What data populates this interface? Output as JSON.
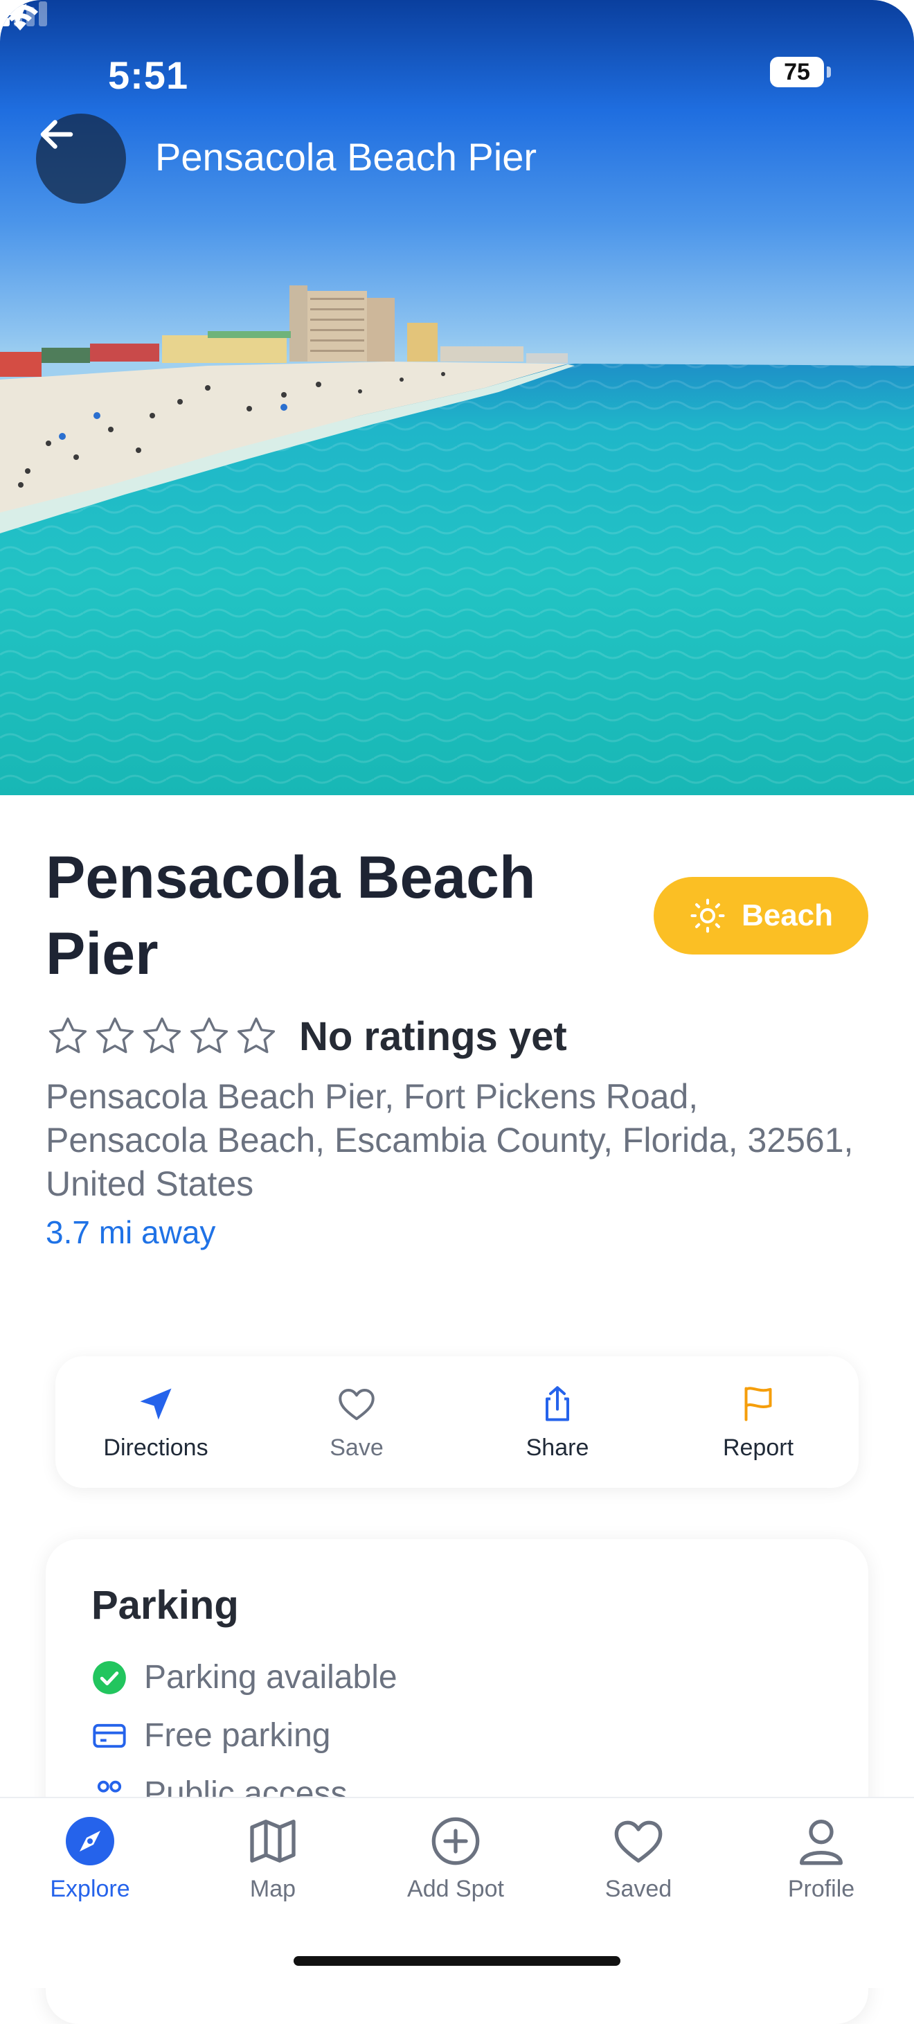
{
  "status_bar": {
    "time": "5:51",
    "battery": "75"
  },
  "header": {
    "title": "Pensacola Beach Pier",
    "back_icon": "arrow-left-icon"
  },
  "place": {
    "name": "Pensacola Beach Pier",
    "category": "Beach",
    "category_icon": "sun-icon",
    "category_color": "#fbbf24",
    "rating_stars": 0,
    "rating_text": "No ratings yet",
    "address": "Pensacola Beach Pier, Fort Pickens Road, Pensacola Beach, Escambia County, Florida, 32561, United States",
    "distance": "3.7 mi away"
  },
  "actions": [
    {
      "label": "Directions",
      "icon": "navigation-arrow-icon",
      "color": "#2563eb"
    },
    {
      "label": "Save",
      "icon": "heart-icon",
      "color": "#6b7280"
    },
    {
      "label": "Share",
      "icon": "share-icon",
      "color": "#2563eb"
    },
    {
      "label": "Report",
      "icon": "flag-icon",
      "color": "#f59e0b"
    }
  ],
  "parking": {
    "title": "Parking",
    "items": [
      {
        "label": "Parking available",
        "icon": "check-circle-icon"
      },
      {
        "label": "Free parking",
        "icon": "credit-card-icon"
      },
      {
        "label": "Public access",
        "icon": "people-icon"
      }
    ]
  },
  "tabs": [
    {
      "label": "Explore",
      "icon": "compass-icon",
      "active": true
    },
    {
      "label": "Map",
      "icon": "map-icon",
      "active": false
    },
    {
      "label": "Add Spot",
      "icon": "plus-circle-icon",
      "active": false
    },
    {
      "label": "Saved",
      "icon": "heart-icon",
      "active": false
    },
    {
      "label": "Profile",
      "icon": "user-icon",
      "active": false
    }
  ],
  "colors": {
    "accent": "#2563eb",
    "link": "#1f72e6",
    "success": "#22c55e"
  }
}
